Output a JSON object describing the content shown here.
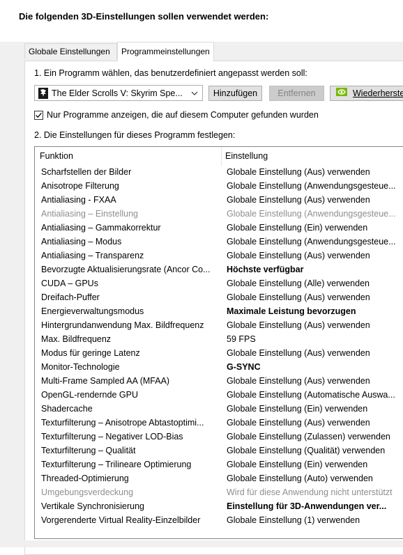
{
  "heading": "Die folgenden 3D-Einstellungen sollen verwendet werden:",
  "tabs": [
    {
      "label": "Globale Einstellungen",
      "active": false
    },
    {
      "label": "Programmeinstellungen",
      "active": true
    }
  ],
  "step1": {
    "label": "1. Ein Programm wählen, das benutzerdefiniert angepasst werden soll:",
    "program_select_value": "The Elder Scrolls V: Skyrim Spe...",
    "add_button": "Hinzufügen",
    "remove_button": "Entfernen",
    "restore_button": "Wiederherste",
    "checkbox_label": "Nur Programme anzeigen, die auf diesem Computer gefunden wurden",
    "checkbox_checked": true
  },
  "step2": {
    "label": "2. Die Einstellungen für dieses Programm festlegen:"
  },
  "table": {
    "headers": {
      "funktion": "Funktion",
      "einstellung": "Einstellung"
    },
    "rows": [
      {
        "funktion": "Scharfstellen der Bilder",
        "einstellung": "Globale Einstellung (Aus) verwenden",
        "bold": false,
        "disabled": false
      },
      {
        "funktion": "Anisotrope Filterung",
        "einstellung": "Globale Einstellung (Anwendungsgesteue...",
        "bold": false,
        "disabled": false
      },
      {
        "funktion": "Antialiasing - FXAA",
        "einstellung": "Globale Einstellung (Aus) verwenden",
        "bold": false,
        "disabled": false
      },
      {
        "funktion": "Antialiasing – Einstellung",
        "einstellung": "Globale Einstellung (Anwendungsgesteue...",
        "bold": false,
        "disabled": true
      },
      {
        "funktion": "Antialiasing – Gammakorrektur",
        "einstellung": "Globale Einstellung (Ein) verwenden",
        "bold": false,
        "disabled": false
      },
      {
        "funktion": "Antialiasing – Modus",
        "einstellung": "Globale Einstellung (Anwendungsgesteue...",
        "bold": false,
        "disabled": false
      },
      {
        "funktion": "Antialiasing – Transparenz",
        "einstellung": "Globale Einstellung (Aus) verwenden",
        "bold": false,
        "disabled": false
      },
      {
        "funktion": "Bevorzugte Aktualisierungsrate (Ancor Co...",
        "einstellung": "Höchste verfügbar",
        "bold": true,
        "disabled": false
      },
      {
        "funktion": "CUDA – GPUs",
        "einstellung": "Globale Einstellung (Alle) verwenden",
        "bold": false,
        "disabled": false
      },
      {
        "funktion": "Dreifach-Puffer",
        "einstellung": "Globale Einstellung (Aus) verwenden",
        "bold": false,
        "disabled": false
      },
      {
        "funktion": "Energieverwaltungsmodus",
        "einstellung": "Maximale Leistung bevorzugen",
        "bold": true,
        "disabled": false
      },
      {
        "funktion": "Hintergrundanwendung Max. Bildfrequenz",
        "einstellung": "Globale Einstellung (Aus) verwenden",
        "bold": false,
        "disabled": false
      },
      {
        "funktion": "Max. Bildfrequenz",
        "einstellung": "59 FPS",
        "bold": false,
        "disabled": false
      },
      {
        "funktion": "Modus für geringe Latenz",
        "einstellung": "Globale Einstellung (Aus) verwenden",
        "bold": false,
        "disabled": false
      },
      {
        "funktion": "Monitor-Technologie",
        "einstellung": "G-SYNC",
        "bold": true,
        "disabled": false
      },
      {
        "funktion": "Multi-Frame Sampled AA (MFAA)",
        "einstellung": "Globale Einstellung (Aus) verwenden",
        "bold": false,
        "disabled": false
      },
      {
        "funktion": "OpenGL-rendernde GPU",
        "einstellung": "Globale Einstellung (Automatische Auswa...",
        "bold": false,
        "disabled": false
      },
      {
        "funktion": "Shadercache",
        "einstellung": "Globale Einstellung (Ein) verwenden",
        "bold": false,
        "disabled": false
      },
      {
        "funktion": "Texturfilterung – Anisotrope Abtastoptimi...",
        "einstellung": "Globale Einstellung (Aus) verwenden",
        "bold": false,
        "disabled": false
      },
      {
        "funktion": "Texturfilterung – Negativer LOD-Bias",
        "einstellung": "Globale Einstellung (Zulassen) verwenden",
        "bold": false,
        "disabled": false
      },
      {
        "funktion": "Texturfilterung – Qualität",
        "einstellung": "Globale Einstellung (Qualität) verwenden",
        "bold": false,
        "disabled": false
      },
      {
        "funktion": "Texturfilterung – Trilineare Optimierung",
        "einstellung": "Globale Einstellung (Ein) verwenden",
        "bold": false,
        "disabled": false
      },
      {
        "funktion": "Threaded-Optimierung",
        "einstellung": "Globale Einstellung (Auto) verwenden",
        "bold": false,
        "disabled": false
      },
      {
        "funktion": "Umgebungsverdeckung",
        "einstellung": "Wird für diese Anwendung nicht unterstützt",
        "bold": false,
        "disabled": true
      },
      {
        "funktion": "Vertikale Synchronisierung",
        "einstellung": "Einstellung für 3D-Anwendungen ver...",
        "bold": true,
        "disabled": false
      },
      {
        "funktion": "Vorgerenderte Virtual Reality-Einzelbilder",
        "einstellung": "Globale Einstellung (1) verwenden",
        "bold": false,
        "disabled": false
      }
    ]
  },
  "colors": {
    "nvidia_green": "#76b900",
    "disabled_text": "#8e8e8e",
    "window_bg": "#f0f0f0"
  },
  "icons": {
    "program": "skyrim-dragon-icon",
    "dropdown": "chevron-down-icon",
    "restore": "nvidia-logo-icon",
    "checkbox": "checkmark-icon"
  }
}
